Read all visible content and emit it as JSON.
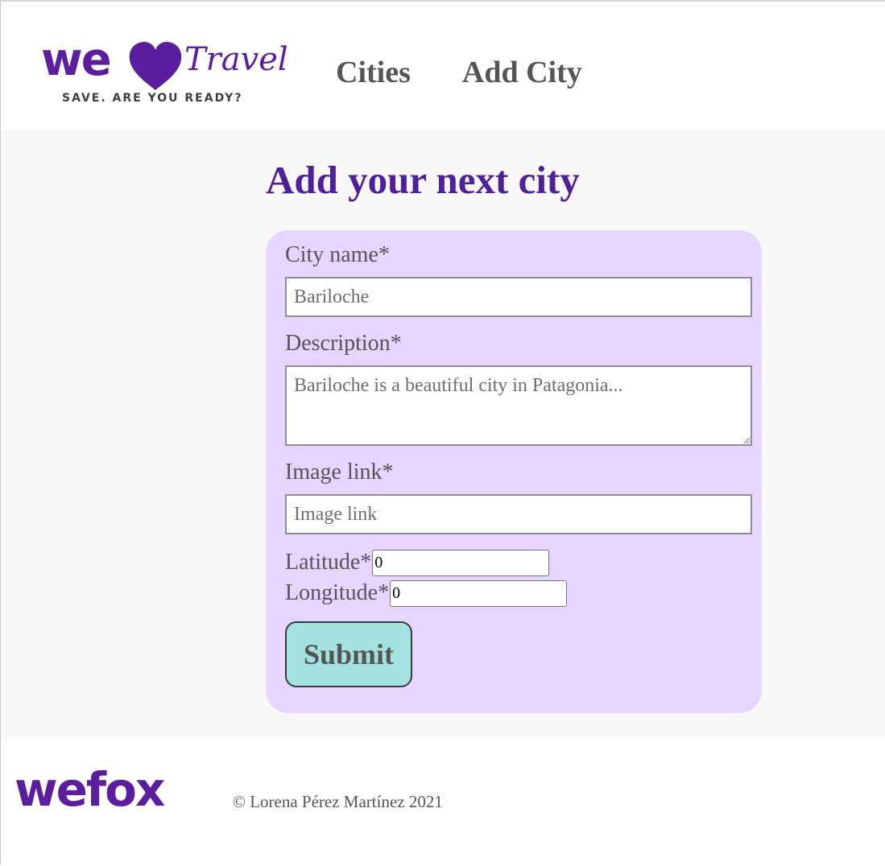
{
  "header": {
    "logo": {
      "word": "we",
      "script": "Travel",
      "tagline": "SAVE. ARE YOU READY?",
      "icon": "heart-icon",
      "color": "#5b1e9e"
    },
    "nav": [
      {
        "label": "Cities"
      },
      {
        "label": "Add City"
      }
    ]
  },
  "main": {
    "title": "Add your next city",
    "title_color": "#4f1f9c",
    "form": {
      "background": "#e6d5ff",
      "city_name": {
        "label": "City name*",
        "placeholder": "Bariloche",
        "value": ""
      },
      "description": {
        "label": "Description*",
        "placeholder": "Bariloche is a beautiful city in Patagonia...",
        "value": ""
      },
      "image_link": {
        "label": "Image link*",
        "placeholder": "Image link",
        "value": ""
      },
      "latitude": {
        "label": "Latitude*",
        "value": "0"
      },
      "longitude": {
        "label": "Longitude*",
        "value": "0"
      },
      "submit": {
        "label": "Submit",
        "color": "#a3e2e0"
      }
    }
  },
  "footer": {
    "logo": "wefox",
    "copyright": "© Lorena Pérez Martínez 2021"
  }
}
